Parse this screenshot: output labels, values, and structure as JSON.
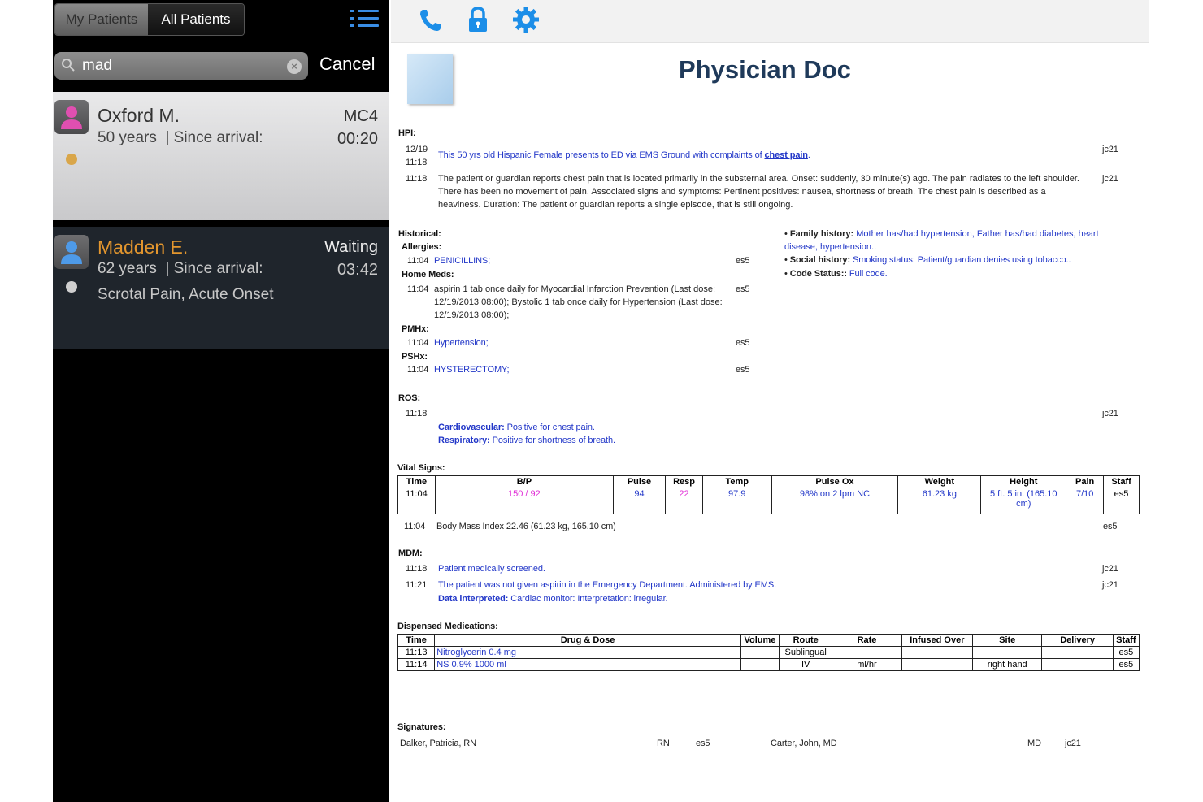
{
  "sidebar": {
    "tabs": {
      "my_patients": "My Patients",
      "all_patients": "All Patients"
    },
    "search": {
      "value": "mad",
      "cancel": "Cancel"
    },
    "patients": [
      {
        "name": "Oxford M.",
        "age": "50 years",
        "since_label": "| Since arrival:",
        "location": "MC4",
        "time": "00:20",
        "complaint": "",
        "dot_color": "#d9a64a"
      },
      {
        "name": "Madden E.",
        "age": "62 years",
        "since_label": "| Since arrival:",
        "location": "Waiting",
        "time": "03:42",
        "complaint": "Scrotal Pain, Acute Onset",
        "dot_color": "#cfcfcf"
      }
    ]
  },
  "toolbar": {
    "icons": [
      "phone-icon",
      "lock-icon",
      "gear-icon"
    ],
    "accent": "#1c8ee8"
  },
  "doc": {
    "title": "Physician Doc",
    "hpi": {
      "label": "HPI:",
      "entries": [
        {
          "date": "12/19",
          "time": "11:18",
          "text": "This 50 yrs old Hispanic Female presents to ED via EMS Ground with complaints of ",
          "bold": "chest pain",
          "tail": ".",
          "staff": "jc21"
        },
        {
          "time": "11:18",
          "text": "The patient or guardian reports chest pain that is located primarily in the substernal area. Onset: suddenly, 30 minute(s) ago. The pain radiates to the left shoulder. There has been no movement of pain. Associated signs and symptoms: Pertinent positives: nausea, shortness of breath. The chest pain is described as a heaviness. Duration: The patient or guardian reports a single episode, that is still ongoing.",
          "staff": "jc21"
        }
      ]
    },
    "historical": {
      "label": "Historical:",
      "allergies_label": "Allergies:",
      "allergies": {
        "time": "11:04",
        "text": "PENICILLINS;",
        "staff": "es5"
      },
      "home_meds_label": "Home Meds:",
      "home_meds": {
        "time": "11:04",
        "text": "aspirin 1 tab once daily for Myocardial Infarction Prevention (Last dose: 12/19/2013 08:00); Bystolic 1 tab once daily for Hypertension (Last dose: 12/19/2013 08:00);",
        "staff": "es5"
      },
      "pmhx_label": "PMHx:",
      "pmhx": {
        "time": "11:04",
        "text": "Hypertension;",
        "staff": "es5"
      },
      "pshx_label": "PSHx:",
      "pshx": {
        "time": "11:04",
        "text": "HYSTERECTOMY;",
        "staff": "es5"
      },
      "family_label": "Family history:",
      "family": "Mother has/had hypertension, Father has/had diabetes, heart disease, hypertension..",
      "social_label": "Social history:",
      "social": "Smoking status: Patient/guardian denies using tobacco..",
      "code_label": "Code Status::",
      "code": "Full code."
    },
    "ros": {
      "label": "ROS:",
      "time": "11:18",
      "staff": "jc21",
      "cardio_label": "Cardiovascular:",
      "cardio": "Positive for chest pain.",
      "resp_label": "Respiratory:",
      "resp": "Positive for shortness of breath."
    },
    "vitals": {
      "label": "Vital Signs:",
      "headers": [
        "Time",
        "B/P",
        "Pulse",
        "Resp",
        "Temp",
        "Pulse Ox",
        "Weight",
        "Height",
        "Pain",
        "Staff"
      ],
      "row": [
        "11:04",
        "150 / 92",
        "94",
        "22",
        "97.9",
        "98% on 2 lpm NC",
        "61.23 kg",
        "5 ft. 5 in. (165.10 cm)",
        "7/10",
        "es5"
      ],
      "bmi": {
        "time": "11:04",
        "text": "Body Mass Index 22.46 (61.23 kg, 165.10 cm)",
        "staff": "es5"
      }
    },
    "mdm": {
      "label": "MDM:",
      "entries": [
        {
          "time": "11:18",
          "text": "Patient medically screened.",
          "staff": "jc21"
        },
        {
          "time": "11:21",
          "text": "The patient was not given aspirin in the Emergency Department. Administered by EMS.",
          "staff": "jc21"
        }
      ],
      "data_label": "Data interpreted:",
      "data_text": "Cardiac monitor: Interpretation: irregular."
    },
    "meds": {
      "label": "Dispensed Medications:",
      "headers": [
        "Time",
        "Drug & Dose",
        "Volume",
        "Route",
        "Rate",
        "Infused Over",
        "Site",
        "Delivery",
        "Staff"
      ],
      "rows": [
        [
          "11:13",
          "Nitroglycerin 0.4 mg",
          "",
          "Sublingual",
          "",
          "",
          "",
          "",
          "es5"
        ],
        [
          "11:14",
          "NS 0.9% 1000 ml",
          "",
          "IV",
          "ml/hr",
          "",
          "right hand",
          "",
          "es5"
        ]
      ]
    },
    "signatures": {
      "label": "Signatures:",
      "entries": [
        {
          "name": "Dalker, Patricia, RN",
          "role": "RN",
          "code": "es5"
        },
        {
          "name": "Carter, John, MD",
          "role": "MD",
          "code": "jc21"
        }
      ]
    }
  }
}
